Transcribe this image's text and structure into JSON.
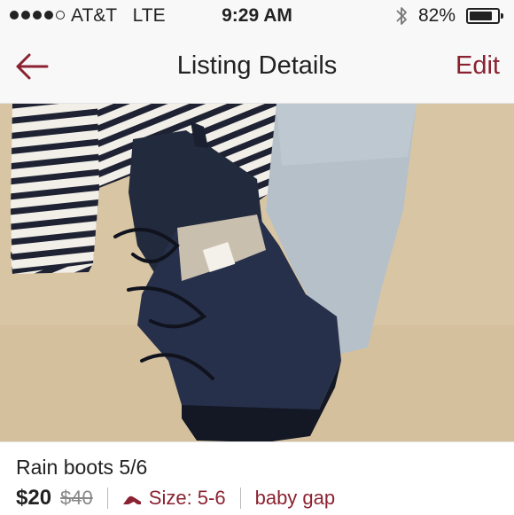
{
  "status_bar": {
    "carrier": "AT&T",
    "network": "LTE",
    "time": "9:29 AM",
    "battery_percent": "82%",
    "battery_level": 0.82,
    "signal_bars_filled": 4,
    "signal_bars_total": 5
  },
  "nav": {
    "title": "Listing Details",
    "edit_label": "Edit",
    "back_icon": "left-arrow-icon",
    "accent_color": "#8b2231"
  },
  "listing": {
    "title": "Rain boots 5/6",
    "price": "$20",
    "original_price": "$40",
    "size_label": "Size: 5-6",
    "size_icon": "high-heel-icon",
    "brand": "baby gap"
  }
}
